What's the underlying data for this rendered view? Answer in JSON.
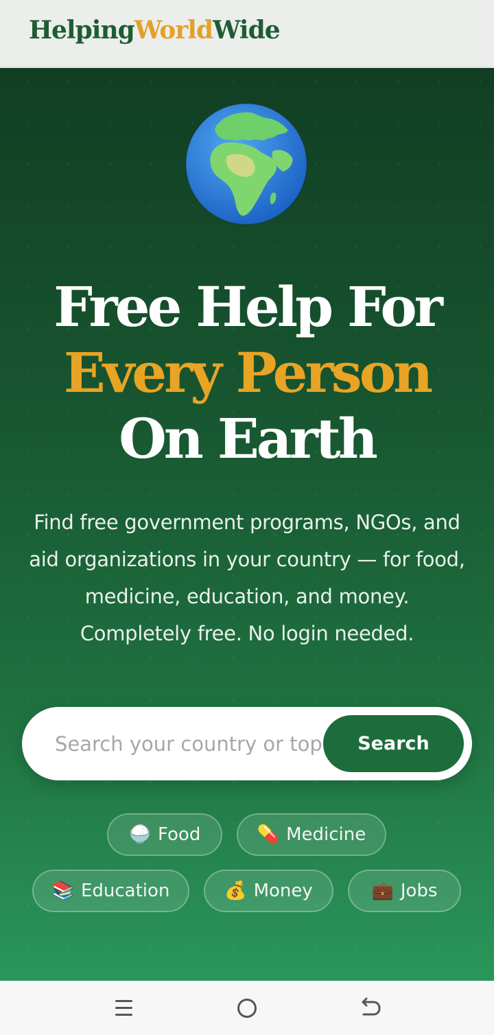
{
  "header": {
    "logo_part1": "Helping",
    "logo_part2": "World",
    "logo_part3": "Wide"
  },
  "hero": {
    "globe_icon": "globe-africa-europe-icon",
    "headline_line1": "Free Help For",
    "headline_line2": "Every Person",
    "headline_line3": "On Earth",
    "subtext_lines": [
      "Find free government programs, NGOs, and",
      "aid organizations in your country — for food,",
      "medicine, education, and money.",
      "Completely free. No login needed."
    ]
  },
  "search": {
    "placeholder": "Search your country or topic",
    "button_label": "Search"
  },
  "chips": [
    {
      "emoji": "🍚",
      "label": "Food"
    },
    {
      "emoji": "💊",
      "label": "Medicine"
    },
    {
      "emoji": "📚",
      "label": "Education"
    },
    {
      "emoji": "💰",
      "label": "Money"
    },
    {
      "emoji": "💼",
      "label": "Jobs"
    }
  ],
  "system_nav": {
    "icons": [
      "menu-icon",
      "home-icon",
      "back-icon"
    ]
  },
  "colors": {
    "brand_green": "#1e5c35",
    "brand_gold": "#e2a12b",
    "button_green": "#1c6d3b"
  }
}
